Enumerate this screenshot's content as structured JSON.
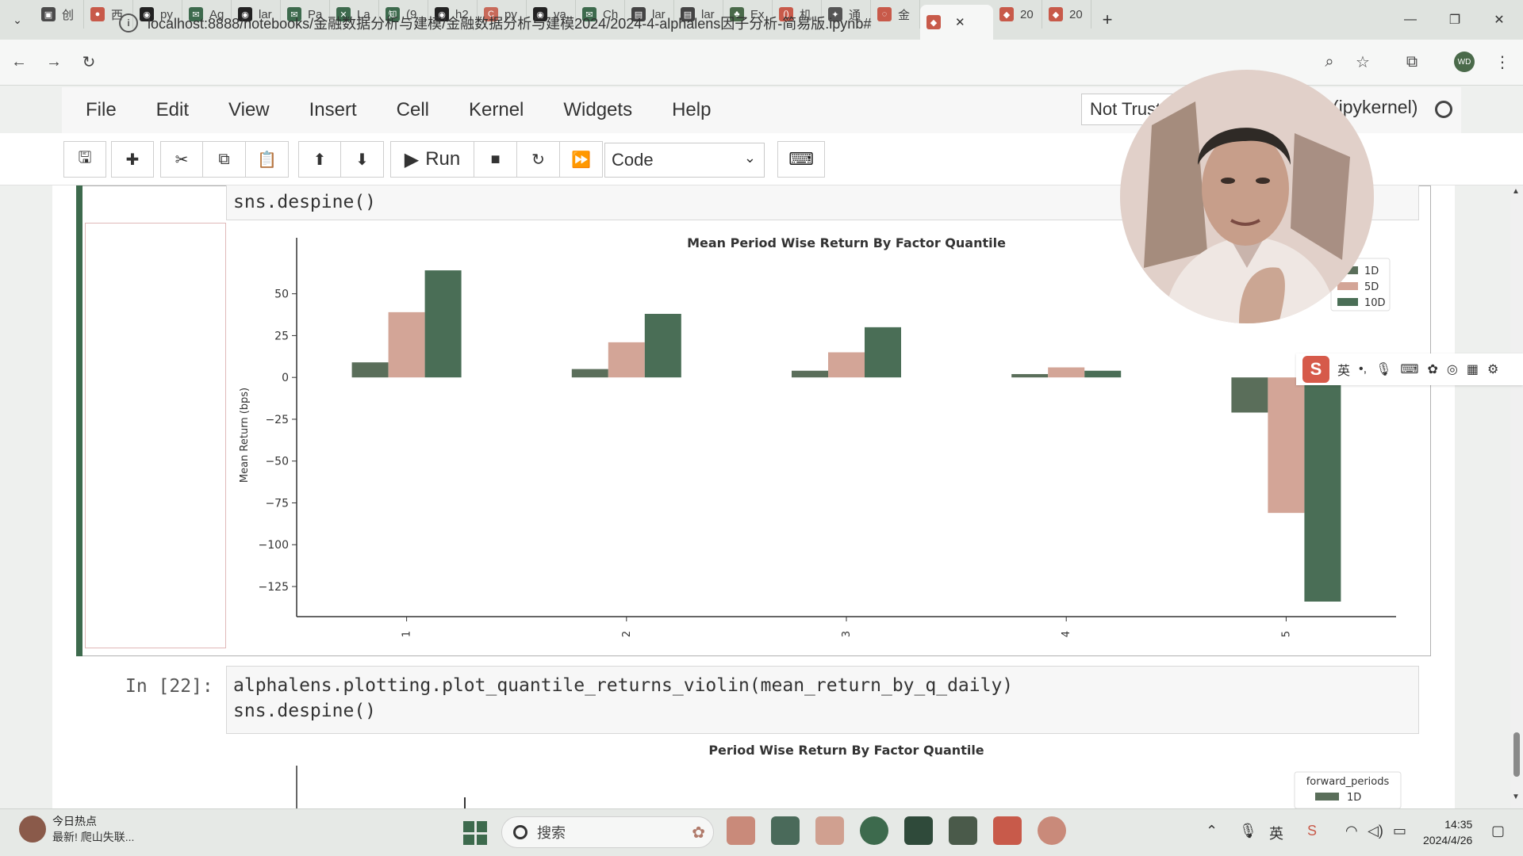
{
  "browser": {
    "tabs": [
      {
        "label": "创",
        "color": "#4a4a4a",
        "glyph": "▣"
      },
      {
        "label": "西",
        "color": "#c85a4a",
        "glyph": "●"
      },
      {
        "label": "py",
        "color": "#222222",
        "glyph": "◉"
      },
      {
        "label": "Ag",
        "color": "#3d6a4d",
        "glyph": "✉"
      },
      {
        "label": "lar",
        "color": "#222222",
        "glyph": "◉"
      },
      {
        "label": "Pa",
        "color": "#3d6a4d",
        "glyph": "✉"
      },
      {
        "label": "La",
        "color": "#3d6a4d",
        "glyph": "✕"
      },
      {
        "label": "(9",
        "color": "#3d6a4d",
        "glyph": "知"
      },
      {
        "label": "h2",
        "color": "#222222",
        "glyph": "◉"
      },
      {
        "label": "py",
        "color": "#c86a5a",
        "glyph": "C"
      },
      {
        "label": "va",
        "color": "#222222",
        "glyph": "◉"
      },
      {
        "label": "Ch",
        "color": "#3d6a4d",
        "glyph": "✉"
      },
      {
        "label": "lar",
        "color": "#444444",
        "glyph": "▤"
      },
      {
        "label": "lar",
        "color": "#444444",
        "glyph": "▤"
      },
      {
        "label": "Ex",
        "color": "#4a6a4a",
        "glyph": "♣"
      },
      {
        "label": "机",
        "color": "#c85a4a",
        "glyph": "()"
      },
      {
        "label": "通",
        "color": "#555555",
        "glyph": "✦"
      },
      {
        "label": "金",
        "color": "#c85a4a",
        "glyph": "◌"
      },
      {
        "label": "",
        "color": "#c85a4a",
        "glyph": "◆",
        "active": true
      },
      {
        "label": "20",
        "color": "#c85a4a",
        "glyph": "◆"
      },
      {
        "label": "20",
        "color": "#c85a4a",
        "glyph": "◆"
      }
    ],
    "url": "localhost:8888/notebooks/金融数据分析与建模/金融数据分析与建模2024/2024-4-alphalens因子分析-简易版.ipynb#",
    "profile": "WD"
  },
  "jupyter": {
    "menu": [
      "File",
      "Edit",
      "View",
      "Insert",
      "Cell",
      "Kernel",
      "Widgets",
      "Help"
    ],
    "trust": "Not Trusted",
    "kernel": "(ipykernel)",
    "run_label": "Run",
    "cell_type": "Code"
  },
  "cells": {
    "cell1_tail": "sns.despine()",
    "cell2_prompt": "In  [22]:",
    "cell2_line1": "alphalens.plotting.plot_quantile_returns_violin(mean_return_by_q_daily)",
    "cell2_line2": "sns.despine()"
  },
  "chart_data": [
    {
      "type": "bar",
      "title": "Mean Period Wise Return By Factor Quantile",
      "ylabel": "Mean Return (bps)",
      "xlabel": "",
      "categories": [
        "1",
        "2",
        "3",
        "4",
        "5"
      ],
      "series": [
        {
          "name": "1D",
          "color": "#5a6e5a",
          "values": [
            9,
            5,
            4,
            2,
            -21
          ]
        },
        {
          "name": "5D",
          "color": "#d3a597",
          "values": [
            39,
            21,
            15,
            6,
            -81
          ]
        },
        {
          "name": "10D",
          "color": "#4a6e56",
          "values": [
            64,
            38,
            30,
            4,
            -134
          ]
        }
      ],
      "yticks": [
        50,
        25,
        0,
        -25,
        -50,
        -75,
        -100,
        -125
      ],
      "ylim": [
        -143,
        74
      ],
      "legend": "top-right"
    },
    {
      "type": "violin",
      "title": "Period Wise Return By Factor Quantile",
      "legend_title": "forward_periods",
      "series": [
        {
          "name": "1D",
          "color": "#5a6e5a"
        }
      ],
      "legend": "top-right"
    }
  ],
  "ime": {
    "mode": "英",
    "punct": "•,"
  },
  "taskbar": {
    "news_title": "今日热点",
    "news_sub": "最新!  爬山失联...",
    "search_placeholder": "搜索",
    "time": "14:35",
    "date": "2024/4/26"
  }
}
